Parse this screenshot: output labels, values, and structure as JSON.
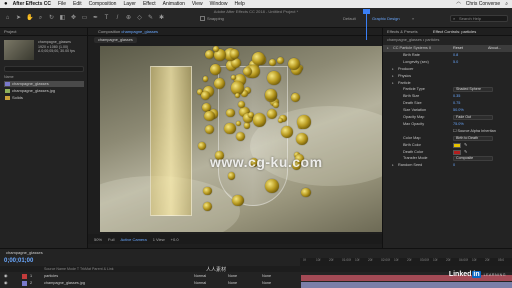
{
  "menubar": {
    "apple": "",
    "app_name": "After Effects CC",
    "items": [
      "File",
      "Edit",
      "Composition",
      "Layer",
      "Effect",
      "Animation",
      "View",
      "Window",
      "Help"
    ],
    "user": "Chris Converse"
  },
  "window_title": "Adobe After Effects CC 2018 - Untitled Project *",
  "toolbar": {
    "snapping": "Snapping",
    "workspaces": [
      "Default",
      "Graphic Design",
      "»"
    ],
    "search_placeholder": "Search Help"
  },
  "project": {
    "tab": "Project",
    "item_name": "champagne_glasses",
    "info_lines": [
      "1920 x 1080 (1.00)",
      "Δ 0;00;05;00, 30.00 fps"
    ],
    "items": [
      "champagne_glasses",
      "champagne_glasses.jpg",
      "Solids"
    ]
  },
  "composition": {
    "tab_prefix": "Composition",
    "tab_name": "champagne_glasses",
    "breadcrumb": "champagne_glasses",
    "watermark": "www.cg-ku.com",
    "viewer_bar": [
      "50%",
      "Full",
      "Active Camera",
      "1 View",
      "+0.0"
    ]
  },
  "effect_controls": {
    "tab_left": "Effects & Presets",
    "tab_right": "Effect Controls: particles",
    "header": "champagne_glasses • particles",
    "rows": [
      {
        "label": "CC Particle Systems II",
        "value": "Reset",
        "extra": "About...",
        "indent": 0,
        "selected": true
      },
      {
        "label": "Birth Rate",
        "value": "0.8",
        "indent": 2
      },
      {
        "label": "Longevity (sec)",
        "value": "5.0",
        "indent": 2
      },
      {
        "label": "Producer",
        "value": "",
        "indent": 1
      },
      {
        "label": "Physics",
        "value": "",
        "indent": 1
      },
      {
        "label": "Particle",
        "value": "",
        "indent": 1
      },
      {
        "label": "Particle Type",
        "value": "Shaded Sphere",
        "indent": 2,
        "dropdown": true
      },
      {
        "label": "Birth Size",
        "value": "0.35",
        "indent": 2
      },
      {
        "label": "Death Size",
        "value": "0.75",
        "indent": 2
      },
      {
        "label": "Size Variation",
        "value": "50.0%",
        "indent": 2
      },
      {
        "label": "Opacity Map",
        "value": "Fade Out",
        "indent": 2,
        "dropdown": true
      },
      {
        "label": "Max Opacity",
        "value": "75.0%",
        "indent": 2
      },
      {
        "label": "",
        "value": "Source Alpha Inheritan",
        "indent": 2,
        "check": true
      },
      {
        "label": "Color Map",
        "value": "Birth to Death",
        "indent": 2,
        "dropdown": true
      },
      {
        "label": "Birth Color",
        "value": "",
        "indent": 2,
        "swatch": "#e6c200"
      },
      {
        "label": "Death Color",
        "value": "",
        "indent": 2,
        "swatch": "#b21e1e"
      },
      {
        "label": "Transfer Mode",
        "value": "Composite",
        "indent": 2,
        "dropdown": true
      },
      {
        "label": "Random Seed",
        "value": "0",
        "indent": 1
      }
    ]
  },
  "timeline": {
    "tab": "champagne_glasses",
    "timecode": "0;00;01;00",
    "columns": "Source Name                                    Mode    T  TrkMat   Parent & Link",
    "layers": [
      {
        "num": "1",
        "name": "particles",
        "mode": "Normal",
        "trkmat": "None",
        "parent": "None",
        "color": "#c23b3b"
      },
      {
        "num": "2",
        "name": "champagne_glasses.jpg",
        "mode": "Normal",
        "trkmat": "None",
        "parent": "None",
        "color": "#7a7acb"
      }
    ],
    "ticks": [
      "0f",
      "10f",
      "20f",
      "01:00f",
      "10f",
      "20f",
      "02:00f",
      "10f",
      "20f",
      "03:00f",
      "10f",
      "20f",
      "04:00f",
      "10f",
      "20f",
      "05:0"
    ],
    "bar_colors": [
      "#a34a55",
      "#7b7fa8"
    ]
  },
  "brand": {
    "linkedin": "Linked",
    "in": "in",
    "learning": "LEARNING",
    "logo": "人人素材"
  }
}
